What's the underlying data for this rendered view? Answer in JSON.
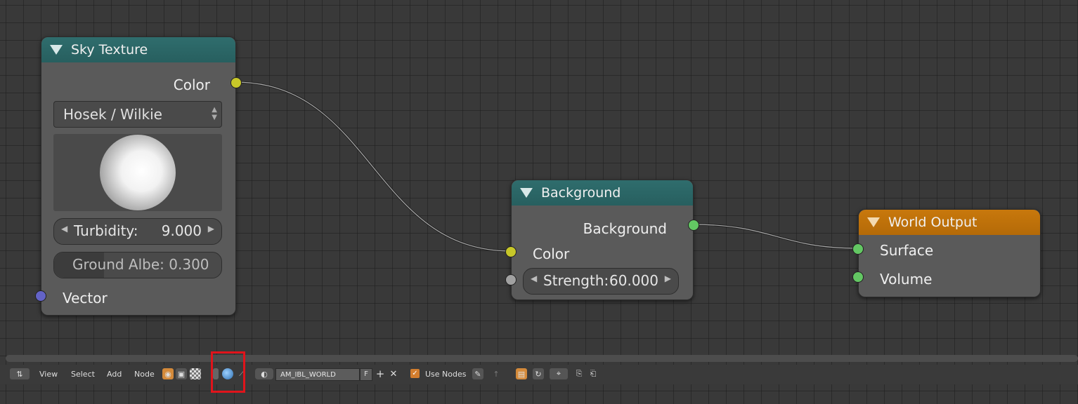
{
  "nodes": {
    "sky_texture": {
      "title": "Sky Texture",
      "output_color": "Color",
      "sky_type": "Hosek / Wilkie",
      "turbidity_label": "Turbidity:",
      "turbidity_value": "9.000",
      "ground_albedo_text": "Ground Albe: 0.300",
      "ground_albedo_fraction": 0.3,
      "input_vector": "Vector"
    },
    "background": {
      "title": "Background",
      "output_background": "Background",
      "input_color": "Color",
      "strength_label": "Strength:",
      "strength_value": "60.000"
    },
    "world_output": {
      "title": "World Output",
      "input_surface": "Surface",
      "input_volume": "Volume"
    }
  },
  "toolbar": {
    "editor_type_icon": "node-editor-icon",
    "menus": [
      "View",
      "Select",
      "Add",
      "Node"
    ],
    "shader_type_icons": [
      "shader-object-icon",
      "shader-world-icon",
      "texture-icon"
    ],
    "world_icon": "world-icon",
    "world_name": "AM_IBL_WORLD",
    "fake_user": "F",
    "use_nodes_label": "Use Nodes",
    "use_nodes_checked": true
  },
  "colors": {
    "socket_color": "#c7c729",
    "socket_shader": "#63c763",
    "socket_vector": "#6363c7",
    "socket_float": "#a1a1a1",
    "header_texture": "#2f6d6d",
    "header_output": "#c8780c",
    "highlight": "#e0141b"
  }
}
